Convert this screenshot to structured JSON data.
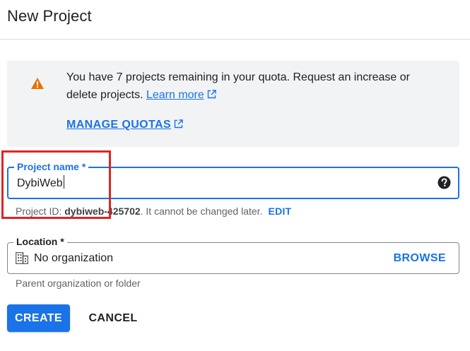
{
  "dialog": {
    "title": "New Project"
  },
  "notice": {
    "text": "You have 7 projects remaining in your quota. Request an increase or delete projects.",
    "learn_more": "Learn more",
    "manage_quotas": "MANAGE QUOTAS",
    "icon": "warning-icon"
  },
  "project_name": {
    "label": "Project name *",
    "value": "DybiWeb",
    "help_icon": "help-icon"
  },
  "project_id": {
    "prefix": "Project ID: ",
    "value": "dybiweb-425702",
    "suffix": ". It cannot be changed later.",
    "edit_label": "EDIT"
  },
  "location": {
    "label": "Location *",
    "value": "No organization",
    "icon": "building-icon",
    "browse_label": "BROWSE",
    "hint": "Parent organization or folder"
  },
  "actions": {
    "create_label": "CREATE",
    "cancel_label": "CANCEL"
  },
  "colors": {
    "accent": "#1a73e8",
    "warning": "#e37400",
    "highlight": "#e02424"
  }
}
